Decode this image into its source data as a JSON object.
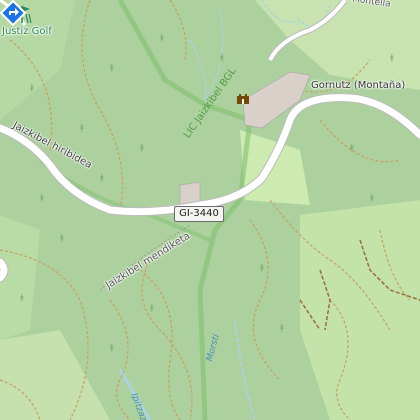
{
  "map": {
    "labels": {
      "golf_label": "Justiz Golf",
      "poi_label": "Gornutz (Montaña)",
      "road_label_left": "Jaizkibel hiribidea",
      "road_label_ridge": "Jaizkibel mendiketa",
      "protected_area_label": "LIC Jaizkibel BGL",
      "stream_label_1": "Morsti",
      "stream_label_2": "Ipitzaz",
      "top_right_road_label": "Montella"
    },
    "road_shield": "GI-3440"
  },
  "icons": {
    "golf": "golf-flag-icon",
    "castle": "castle-icon",
    "route_marker": "directions-pin-icon"
  },
  "colors": {
    "forest": "#add19e",
    "meadow": "#cdebb0",
    "road": "#ffffff",
    "road_casing": "#bbbbbb",
    "path": "#c8a060",
    "boundary": "#7bbf6a",
    "water": "#aad3df",
    "marker": "#1a73e8",
    "golf": "#2e8b57"
  }
}
